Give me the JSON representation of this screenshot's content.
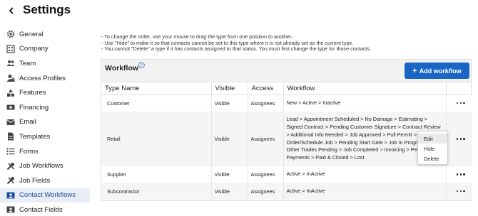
{
  "header": {
    "title": "Settings",
    "back_icon": "chevron-left-icon"
  },
  "sidebar": {
    "items": [
      {
        "label": "General",
        "icon": "gear-icon"
      },
      {
        "label": "Company",
        "icon": "building-icon"
      },
      {
        "label": "Team",
        "icon": "people-icon"
      },
      {
        "label": "Access Profiles",
        "icon": "user-lock-icon"
      },
      {
        "label": "Features",
        "icon": "shapes-icon"
      },
      {
        "label": "Financing",
        "icon": "money-icon"
      },
      {
        "label": "Email",
        "icon": "envelope-icon"
      },
      {
        "label": "Templates",
        "icon": "document-icon"
      },
      {
        "label": "Forms",
        "icon": "list-icon"
      },
      {
        "label": "Job Workflows",
        "icon": "tools-icon"
      },
      {
        "label": "Job Fields",
        "icon": "tools-icon"
      },
      {
        "label": "Contact Workflows",
        "icon": "contact-card-icon",
        "active": true
      },
      {
        "label": "Contact Fields",
        "icon": "contact-card-icon"
      }
    ]
  },
  "notes": [
    "- To change the order, use your mouse to drag the type from one position to another.",
    "- Use \"Hide\" to make it so that contacts cannot be set to this type where it is not already set as the current type.",
    "- You cannot \"Delete\" a type if it has contacts assigned to that status. You must first change the type for those contacts."
  ],
  "panel": {
    "title": "Workflow",
    "add_button": "Add workflow"
  },
  "table": {
    "columns": [
      "Type Name",
      "Visible",
      "Access",
      "Workflow",
      ""
    ],
    "rows": [
      {
        "name": "Customer",
        "visible": "Visible",
        "access": "Assignees",
        "workflow_lines": [
          "New > Active > Inactive"
        ]
      },
      {
        "name": "Retail",
        "visible": "Visible",
        "access": "Assignees",
        "workflow_lines": [
          "Lead > Appointment Scheduled > No Damage > Estimating >",
          "Signed Contract > Pending Customer Signature > Contract Review",
          "> Additional Info Needed > Job Approved > Pull Permit >",
          "Order/Schedule Job > Pending Start Date > Job In Progre",
          "Other Trades Pending > Job Completed > Invoicing > Pen",
          "Payments > Paid & Closed > Lost"
        ]
      },
      {
        "name": "Supplier",
        "visible": "Visible",
        "access": "Assignees",
        "workflow_lines": [
          "Active > InActive"
        ]
      },
      {
        "name": "Subcontractor",
        "visible": "Visible",
        "access": "Assignees",
        "workflow_lines": [
          "Active > InActive"
        ]
      }
    ]
  },
  "context_menu": {
    "items": [
      "Edit",
      "Hide",
      "Delete"
    ]
  },
  "colors": {
    "accent": "#1b65c4",
    "active_nav_bg": "#e9eef6",
    "active_nav_text": "#1d4f9c"
  }
}
